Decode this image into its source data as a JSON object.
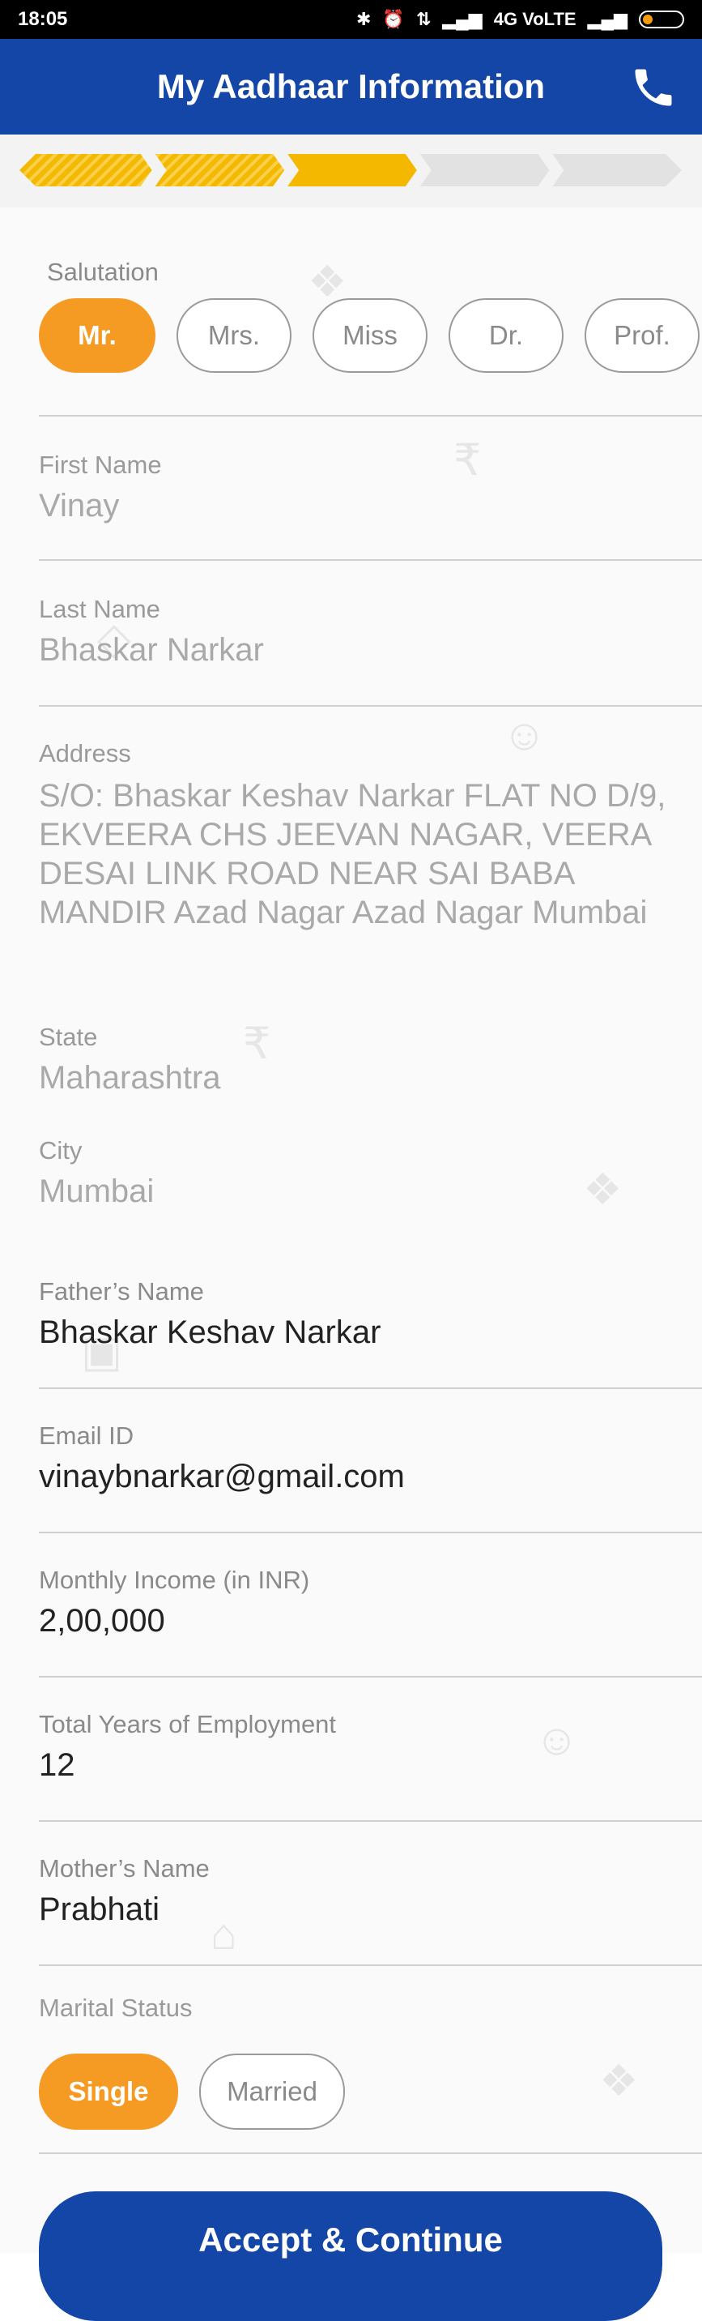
{
  "status_bar": {
    "time": "18:05",
    "network": "4G VoLTE",
    "icons": [
      "bluetooth-icon",
      "alarm-icon",
      "data-arrows-icon",
      "signal-icon",
      "signal-icon",
      "battery-icon"
    ]
  },
  "header": {
    "title": "My Aadhaar Information",
    "phone_icon": "phone-icon"
  },
  "progress": {
    "total_steps": 5,
    "completed_steps": 3,
    "active_color": "#f5b800",
    "inactive_color": "#e2e2e2"
  },
  "salutation": {
    "label": "Salutation",
    "options": [
      "Mr.",
      "Mrs.",
      "Miss",
      "Dr.",
      "Prof."
    ],
    "selected": "Mr."
  },
  "fields": {
    "first_name": {
      "label": "First Name",
      "value": "Vinay"
    },
    "last_name": {
      "label": "Last Name",
      "value": "Bhaskar Narkar"
    },
    "address": {
      "label": "Address",
      "value": "S/O: Bhaskar Keshav Narkar FLAT NO D/9, EKVEERA CHS JEEVAN NAGAR, VEERA DESAI LINK ROAD NEAR SAI BABA MANDIR Azad Nagar Azad Nagar Mumbai"
    },
    "state": {
      "label": "State",
      "value": "Maharashtra"
    },
    "city": {
      "label": "City",
      "value": "Mumbai"
    },
    "father_name": {
      "label": "Father’s Name",
      "value": "Bhaskar Keshav Narkar"
    },
    "email": {
      "label": "Email ID",
      "value": "vinaybnarkar@gmail.com"
    },
    "monthly_income": {
      "label": "Monthly Income (in INR)",
      "value": "2,00,000"
    },
    "employment_years": {
      "label": "Total Years of Employment",
      "value": "12"
    },
    "mother_name": {
      "label": "Mother’s Name",
      "value": "Prabhati"
    }
  },
  "marital_status": {
    "label": "Marital Status",
    "options": [
      "Single",
      "Married"
    ],
    "selected": "Single"
  },
  "cta": {
    "label": "Accept & Continue"
  },
  "colors": {
    "primary": "#1346a6",
    "accent": "#f59a23"
  }
}
